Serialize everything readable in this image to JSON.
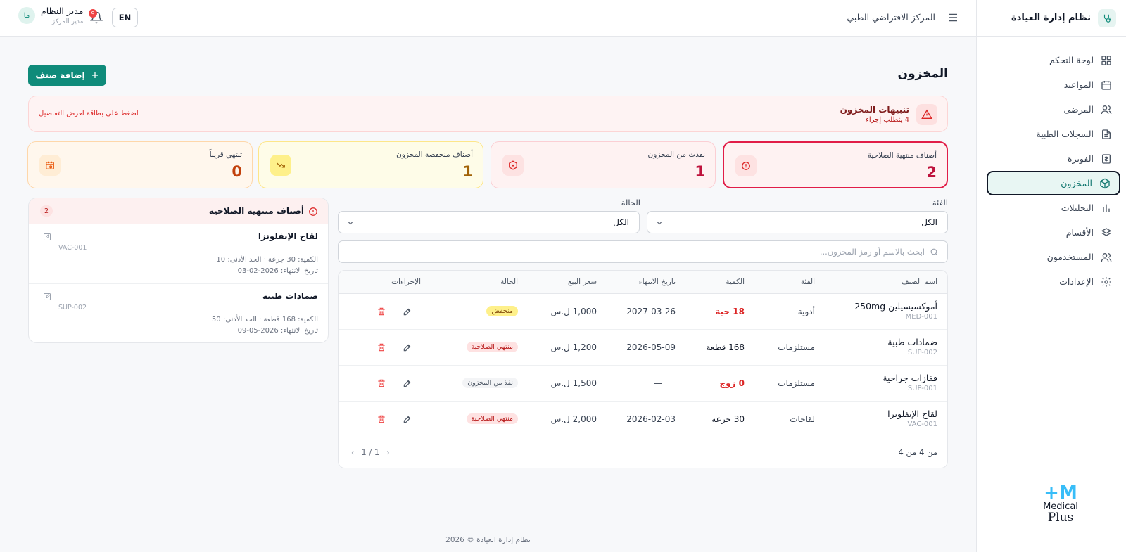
{
  "app": {
    "title": "نظام إدارة العيادة"
  },
  "sidebar": {
    "items": [
      {
        "label": "لوحة التحكم",
        "icon": "dashboard-icon",
        "active": false
      },
      {
        "label": "المواعيد",
        "icon": "calendar-icon",
        "active": false
      },
      {
        "label": "المرضى",
        "icon": "users-icon",
        "active": false
      },
      {
        "label": "السجلات الطبية",
        "icon": "file-text-icon",
        "active": false
      },
      {
        "label": "الفوترة",
        "icon": "receipt-icon",
        "active": false
      },
      {
        "label": "المخزون",
        "icon": "package-icon",
        "active": true
      },
      {
        "label": "التحليلات",
        "icon": "bar-chart-icon",
        "active": false
      },
      {
        "label": "الأقسام",
        "icon": "layers-icon",
        "active": false
      },
      {
        "label": "المستخدمون",
        "icon": "user-group-icon",
        "active": false
      },
      {
        "label": "الإعدادات",
        "icon": "gear-icon",
        "active": false
      }
    ],
    "logo": {
      "line1": "Medical",
      "line2": "Plus"
    }
  },
  "topbar": {
    "center_name": "المركز الافتراضي الطبي",
    "user": {
      "name": "مدير النظام",
      "role": "مدير المركز",
      "initials": "ما"
    },
    "notifications_count": "9",
    "language_button": "EN"
  },
  "page": {
    "title": "المخزون",
    "add_button": "إضافة صنف"
  },
  "alerts": {
    "title": "تنبيهات المخزون",
    "subtitle": "4 يتطلب إجراء",
    "hint": "اضغط على بطاقة لعرض التفاصيل"
  },
  "stats": {
    "expired": {
      "label": "أصناف منتهية الصلاحية",
      "value": "2"
    },
    "out_of_stock": {
      "label": "نفذت من المخزون",
      "value": "1"
    },
    "low_stock": {
      "label": "أصناف منخفضة المخزون",
      "value": "1"
    },
    "expiring_soon": {
      "label": "تنتهي قريباً",
      "value": "0"
    }
  },
  "filters": {
    "category": {
      "label": "الفئة",
      "value": "الكل"
    },
    "status": {
      "label": "الحالة",
      "value": "الكل"
    },
    "search_placeholder": "ابحث بالاسم أو رمز المخزون..."
  },
  "table": {
    "headers": {
      "name": "اسم الصنف",
      "category": "الفئة",
      "quantity": "الكمية",
      "expiry": "تاريخ الانتهاء",
      "price": "سعر البيع",
      "status": "الحالة",
      "actions": "الإجراءات"
    },
    "rows": [
      {
        "name": "أموكسيسيلين 250mg",
        "code": "MED-001",
        "category": "أدوية",
        "quantity": "18 حبة",
        "qty_alert": true,
        "expiry": "2027-03-26",
        "price": "1,000 ل.س",
        "status": "منخفض",
        "status_type": "low"
      },
      {
        "name": "ضمادات طبية",
        "code": "SUP-002",
        "category": "مستلزمات",
        "quantity": "168 قطعة",
        "qty_alert": false,
        "expiry": "2026-05-09",
        "price": "1,200 ل.س",
        "status": "منتهي الصلاحية",
        "status_type": "expired"
      },
      {
        "name": "قفازات جراحية",
        "code": "SUP-001",
        "category": "مستلزمات",
        "quantity": "0 زوج",
        "qty_alert": true,
        "expiry": "—",
        "price": "1,500 ل.س",
        "status": "نفذ من المخزون",
        "status_type": "out"
      },
      {
        "name": "لقاح الإنفلونزا",
        "code": "VAC-001",
        "category": "لقاحات",
        "quantity": "30 جرعة",
        "qty_alert": false,
        "expiry": "2026-02-03",
        "price": "2,000 ل.س",
        "status": "منتهي الصلاحية",
        "status_type": "expired"
      }
    ],
    "pagination": {
      "summary": "من 4 من 4",
      "page": "1 / 1"
    }
  },
  "expired_panel": {
    "title": "أصناف منتهية الصلاحية",
    "count": "2",
    "items": [
      {
        "name": "لقاح الإنفلونزا",
        "code": "VAC-001",
        "qty_line": "الكمية: 30 جرعة · الحد الأدنى: 10",
        "expiry_line": "تاريخ الانتهاء: 2026-02-03"
      },
      {
        "name": "ضمادات طبية",
        "code": "SUP-002",
        "qty_line": "الكمية: 168 قطعة · الحد الأدنى: 50",
        "expiry_line": "تاريخ الانتهاء: 2026-05-09"
      }
    ]
  },
  "footer": {
    "text": "نظام إدارة العيادة © 2026"
  },
  "colors": {
    "primary": "#0f8b7a",
    "danger": "#dc2626",
    "warning": "#a16207",
    "orange": "#ea580c"
  }
}
